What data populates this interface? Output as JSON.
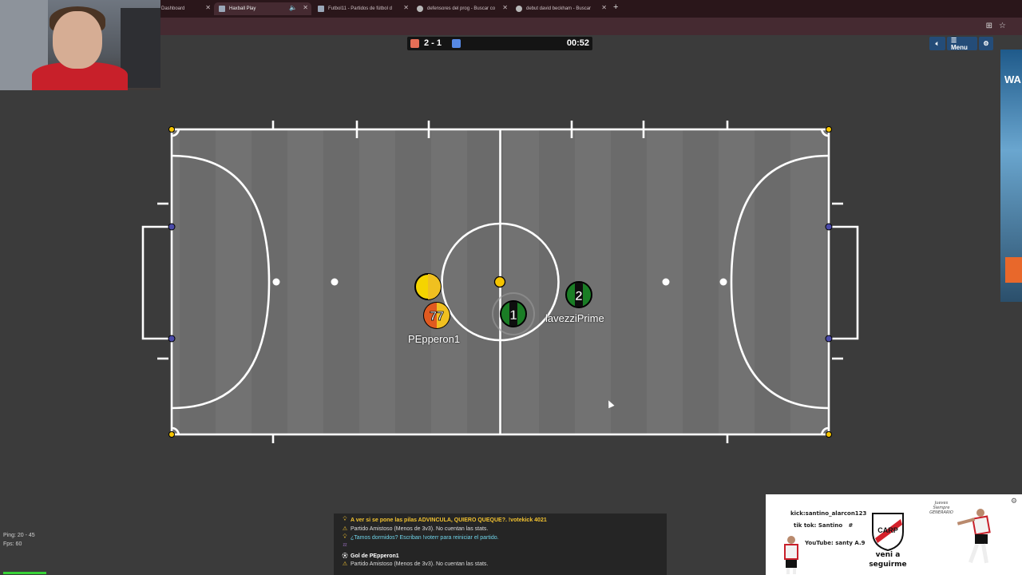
{
  "browser": {
    "tabs": [
      {
        "label": "Dashboard",
        "active": false,
        "audio": false
      },
      {
        "label": "Haxball Play",
        "active": true,
        "audio": true
      },
      {
        "label": "Futbol11 - Partidos de fútbol d",
        "active": false,
        "audio": false
      },
      {
        "label": "defensores del prog - Buscar co",
        "active": false,
        "audio": false
      },
      {
        "label": "debut david beckham - Buscar",
        "active": false,
        "audio": false
      }
    ],
    "new_tab": "+"
  },
  "scoreboard": {
    "red_score": 2,
    "blue_score": 1,
    "score_text": "2 - 1",
    "time": "00:52",
    "red_color": "#e56e56",
    "blue_color": "#5689e5"
  },
  "top_controls": {
    "sound_icon": "speaker-icon",
    "menu_label": "☰ Menu",
    "settings_icon": "gear-icon"
  },
  "players": [
    {
      "number": "",
      "name": "",
      "color": "#f5d400",
      "team": "red"
    },
    {
      "number": "77",
      "name": "PEpperon1",
      "color": "#f0c020",
      "team": "red"
    },
    {
      "number": "1",
      "name": "",
      "color": "#1f8f2a",
      "team": "blue"
    },
    {
      "number": "2",
      "name": "lavezziPrime",
      "color": "#1f8f2a",
      "team": "blue"
    }
  ],
  "ball": {
    "color": "#f5c400"
  },
  "side_ad": {
    "text": "WA"
  },
  "stats": {
    "ping": "Ping: 20 - 45",
    "fps": "Fps: 60"
  },
  "chat": [
    {
      "icon": "bulb-icon",
      "text": "A ver si se pone las pilas ADVINCULA, QUIERO QUEQUE?. !votekick 4021",
      "color": "#f2c230",
      "bold": true
    },
    {
      "icon": "warning-icon",
      "text": "Partido Amistoso (Menos de 3v3). No cuentan las stats.",
      "color": "#dddddd",
      "bold": false
    },
    {
      "icon": "bulb-icon",
      "text": "¿Tamos dormidos? Escriban !voterr para reiniciar el partido.",
      "color": "#6fd3e8",
      "bold": false
    },
    {
      "icon": "sleep-icon",
      "text": "",
      "color": "#dddddd",
      "bold": false
    },
    {
      "icon": "ball-icon",
      "text": "Gol de PEpperon1",
      "color": "#ffffff",
      "bold": true
    },
    {
      "icon": "warning-icon",
      "text": "Partido Amistoso (Menos de 3v3). No cuentan las stats.",
      "color": "#dddddd",
      "bold": false
    }
  ],
  "streambox": {
    "kick": "kick:santino_alarcon123",
    "tiktok": "tik tok: Santino",
    "youtube": "YouTube: santy A.9",
    "cta": "veni a\nseguirme",
    "sig": "Jueves\nSiempre\nGENERARIO",
    "crest_text": "CARP"
  }
}
